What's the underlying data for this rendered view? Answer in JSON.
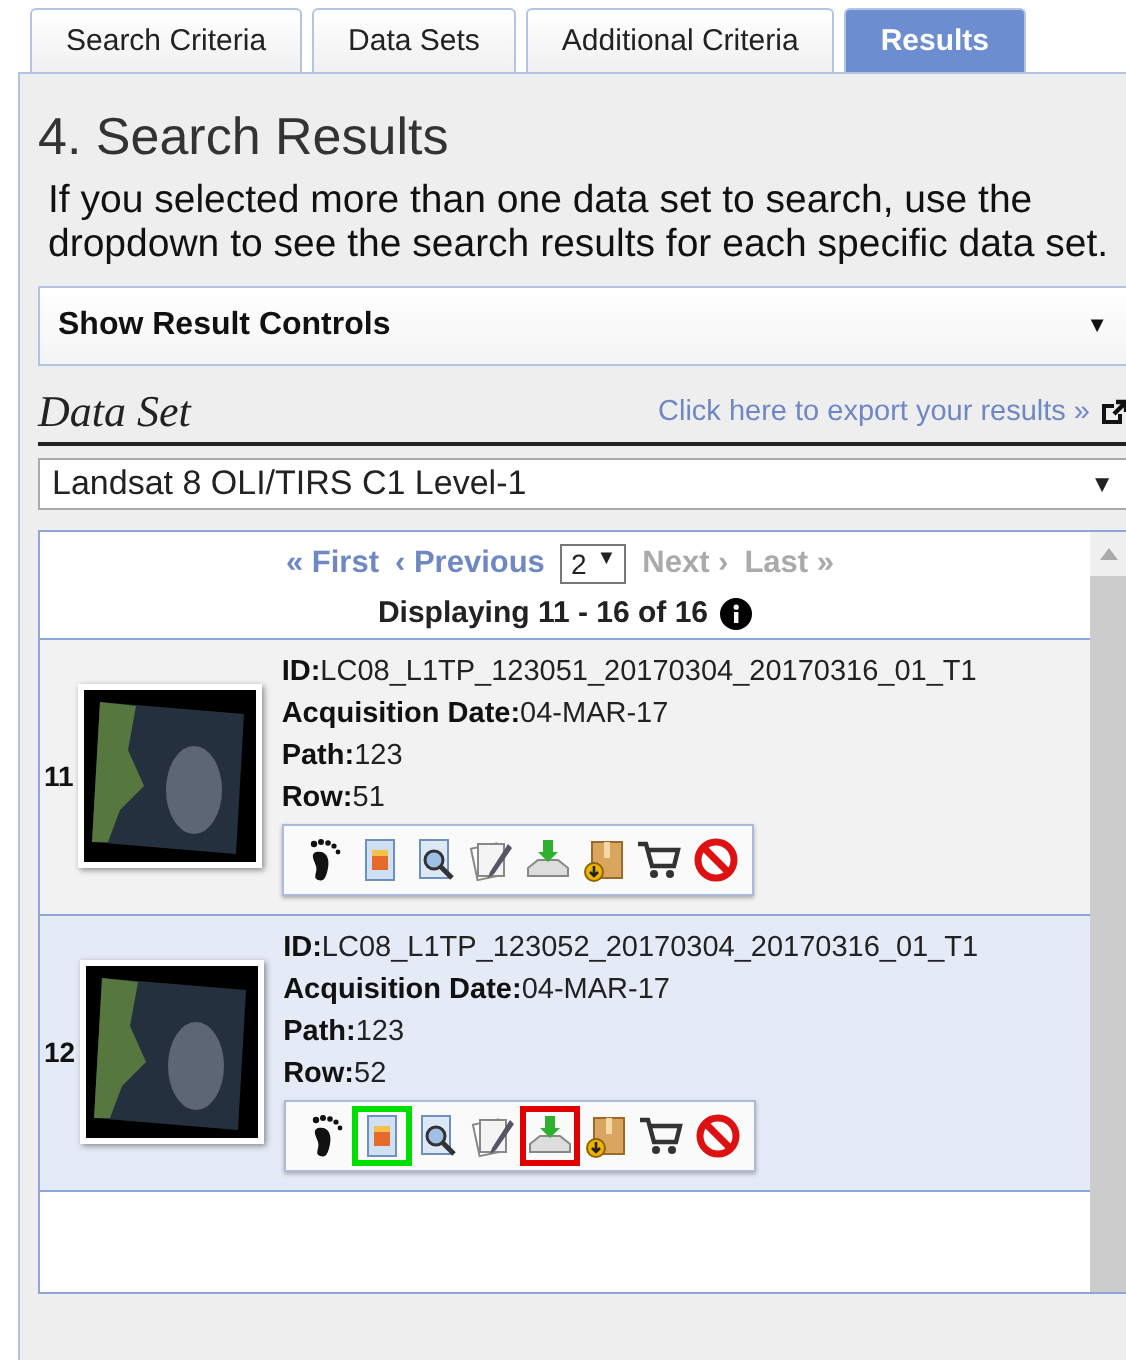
{
  "tabs": [
    {
      "label": "Search Criteria",
      "selected": false
    },
    {
      "label": "Data Sets",
      "selected": false
    },
    {
      "label": "Additional Criteria",
      "selected": false
    },
    {
      "label": "Results",
      "selected": true
    }
  ],
  "heading": "4. Search Results",
  "intro": "If you selected more than one data set to search, use the dropdown to see the search results for each specific data set.",
  "result_controls": {
    "label": "Show Result Controls",
    "arrow": "▼"
  },
  "data_set": {
    "title": "Data Set",
    "export_link": "Click here to export your results »",
    "select_value": "Landsat 8 OLI/TIRS C1 Level-1",
    "select_arrow": "▼"
  },
  "pager": {
    "links": [
      {
        "label": "« First",
        "disabled": false
      },
      {
        "label": "‹ Previous",
        "disabled": false
      }
    ],
    "page": "2",
    "page_arrow": "▼",
    "links_after": [
      {
        "label": "Next ›",
        "disabled": true
      },
      {
        "label": "Last »",
        "disabled": true
      }
    ],
    "summary": "Displaying 11 - 16 of 16"
  },
  "results": [
    {
      "number": "11",
      "selected": false,
      "fields": [
        {
          "label": "ID:",
          "value": "LC08_L1TP_123051_20170304_20170316_01_T1"
        },
        {
          "label": "Acquisition Date:",
          "value": "04-MAR-17"
        },
        {
          "label": "Path:",
          "value": "123"
        },
        {
          "label": "Row:",
          "value": "51"
        }
      ],
      "tools": [
        {
          "kind": "footprint"
        },
        {
          "kind": "browse"
        },
        {
          "kind": "metadata"
        },
        {
          "kind": "compare"
        },
        {
          "kind": "download"
        },
        {
          "kind": "order"
        },
        {
          "kind": "cart"
        },
        {
          "kind": "exclude"
        }
      ]
    },
    {
      "number": "12",
      "selected": true,
      "fields": [
        {
          "label": "ID:",
          "value": "LC08_L1TP_123052_20170304_20170316_01_T1"
        },
        {
          "label": "Acquisition Date:",
          "value": "04-MAR-17"
        },
        {
          "label": "Path:",
          "value": "123"
        },
        {
          "label": "Row:",
          "value": "52"
        }
      ],
      "tools": [
        {
          "kind": "footprint"
        },
        {
          "kind": "browse",
          "color": "#00e000"
        },
        {
          "kind": "metadata"
        },
        {
          "kind": "compare"
        },
        {
          "kind": "download",
          "color": "#e00000"
        },
        {
          "kind": "order"
        },
        {
          "kind": "cart"
        },
        {
          "kind": "exclude"
        }
      ]
    }
  ]
}
